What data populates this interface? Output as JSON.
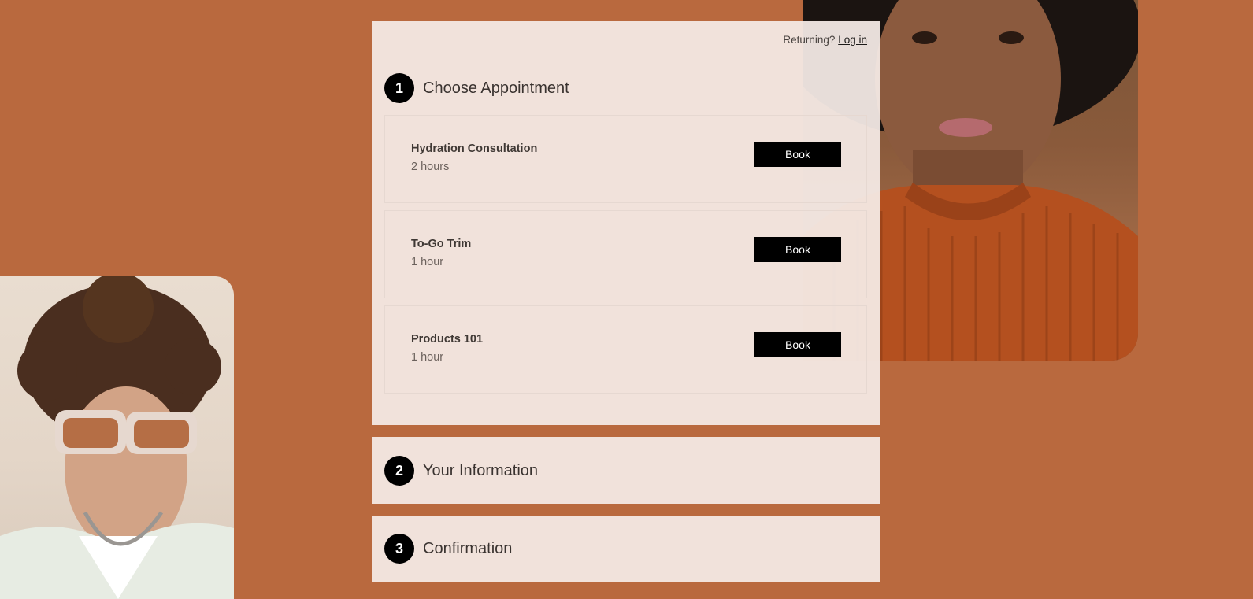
{
  "header": {
    "returning_text": "Returning?",
    "login_link": "Log in"
  },
  "steps": [
    {
      "number": "1",
      "title": "Choose Appointment"
    },
    {
      "number": "2",
      "title": "Your Information"
    },
    {
      "number": "3",
      "title": "Confirmation"
    }
  ],
  "appointments": [
    {
      "name": "Hydration Consultation",
      "duration": "2 hours",
      "button": "Book"
    },
    {
      "name": "To-Go Trim",
      "duration": "1 hour",
      "button": "Book"
    },
    {
      "name": "Products 101",
      "duration": "1 hour",
      "button": "Book"
    }
  ],
  "colors": {
    "background": "#b9693e",
    "panel": "#f4eae5",
    "button": "#000000"
  }
}
